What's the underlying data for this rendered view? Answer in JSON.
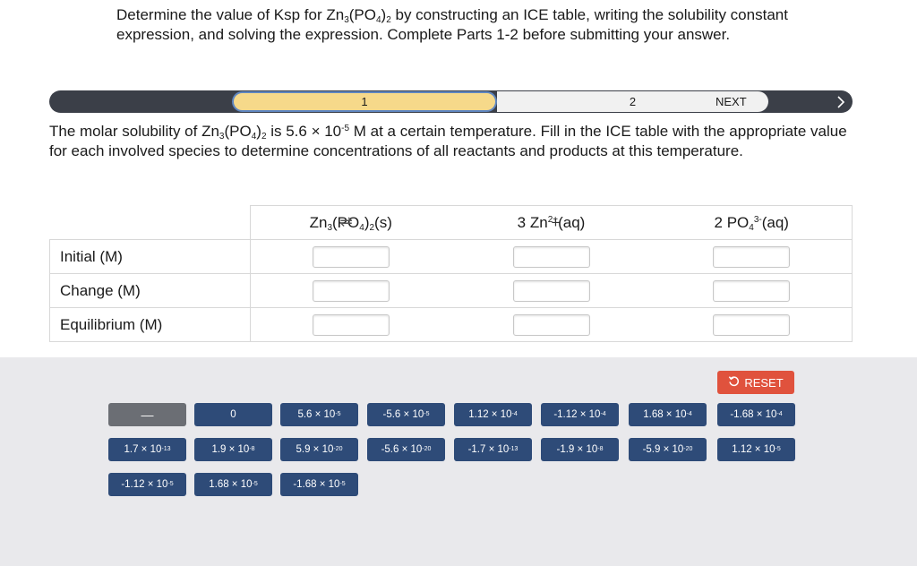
{
  "question": {
    "p1": "Determine the value of Ksp for Zn",
    "s1": "3",
    "p2": "(PO",
    "s2": "4",
    "p3": ")",
    "s3": "2",
    "p4": " by constructing an ICE table, writing the solubility constant expression, and solving the expression. Complete Parts 1-2 before submitting your answer."
  },
  "progress": {
    "step1": "1",
    "step2": "2",
    "next_label": "NEXT",
    "next_icon": "chevron-right-icon",
    "active_step": 1
  },
  "part": {
    "p1": "The molar solubility of Zn",
    "s1": "3",
    "p2": "(PO",
    "s2": "4",
    "p3": ")",
    "s3": "2",
    "p4": " is 5.6 × 10",
    "e1": "-5",
    "p5": " M at a certain temperature. Fill in the ICE table with the appropriate value for each involved species to determine concentrations of all reactants and products at this temperature."
  },
  "ice": {
    "reactant": {
      "a": "Zn",
      "b": "3",
      "c": "(PO",
      "d": "4",
      "e": ")",
      "f": "2",
      "g": "(s)"
    },
    "arrow": "⇌",
    "product1": {
      "a": "3 Zn",
      "b": "2+",
      "c": "(aq)"
    },
    "plus": "+",
    "product2": {
      "a": "2 PO",
      "b": "4",
      "c": "3-",
      "d": "(aq)"
    },
    "rows": [
      "Initial (M)",
      "Change (M)",
      "Equilibrium (M)"
    ]
  },
  "reset_label": "RESET",
  "reset_icon": "undo-icon",
  "tiles": [
    {
      "m": "—",
      "e": ""
    },
    {
      "m": "0",
      "e": ""
    },
    {
      "m": "5.6 × 10",
      "e": "-5"
    },
    {
      "m": "-5.6 × 10",
      "e": "-5"
    },
    {
      "m": "1.12 × 10",
      "e": "-4"
    },
    {
      "m": "-1.12 × 10",
      "e": "-4"
    },
    {
      "m": "1.68 × 10",
      "e": "-4"
    },
    {
      "m": "-1.68 × 10",
      "e": "-4"
    },
    {
      "m": "1.7 × 10",
      "e": "-13"
    },
    {
      "m": "1.9 × 10",
      "e": "-8"
    },
    {
      "m": "5.9 × 10",
      "e": "-20"
    },
    {
      "m": "-5.6 × 10",
      "e": "-20"
    },
    {
      "m": "-1.7 × 10",
      "e": "-13"
    },
    {
      "m": "-1.9 × 10",
      "e": "-8"
    },
    {
      "m": "-5.9 × 10",
      "e": "-20"
    },
    {
      "m": "1.12 × 10",
      "e": "-5"
    },
    {
      "m": "-1.12 × 10",
      "e": "-5"
    },
    {
      "m": "1.68 × 10",
      "e": "-5"
    },
    {
      "m": "-1.68 × 10",
      "e": "-5"
    }
  ]
}
